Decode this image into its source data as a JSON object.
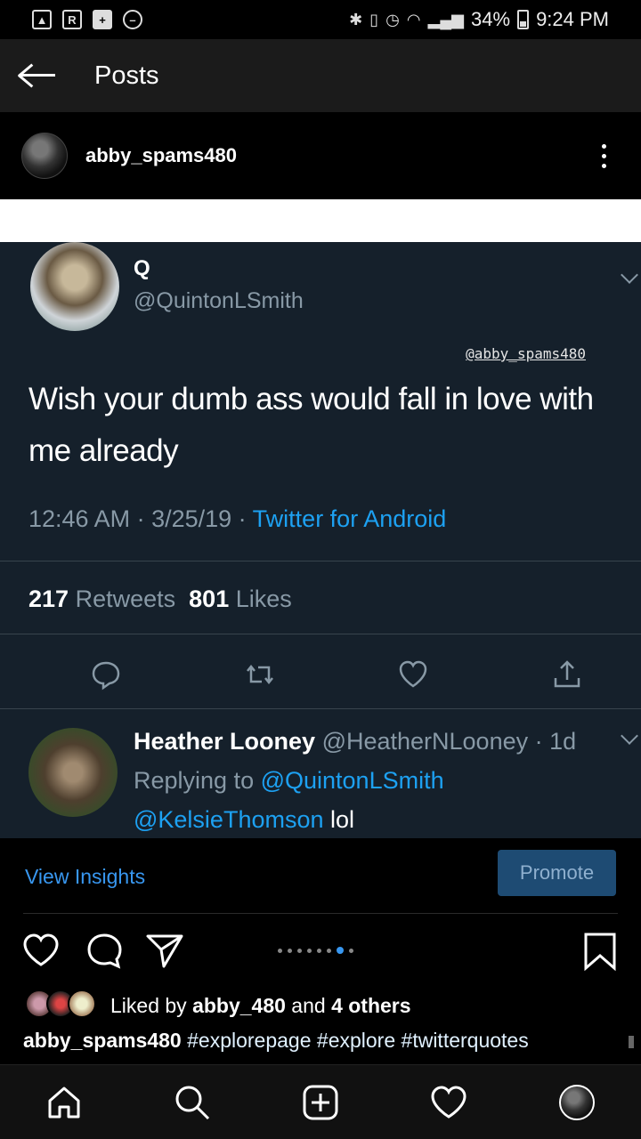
{
  "status_bar": {
    "left_icons": [
      "image-icon",
      "r-icon",
      "plus-box-icon",
      "minus-circle-icon"
    ],
    "battery": "34%",
    "time": "9:24 PM"
  },
  "header": {
    "title": "Posts"
  },
  "post": {
    "username": "abby_spams480",
    "tweet": {
      "name": "Q",
      "handle": "@QuintonLSmith",
      "watermark": "@abby_spams480",
      "text": "Wish your dumb ass would fall in love with me already",
      "time": "12:46 AM · 3/25/19 · ",
      "source": "Twitter for Android",
      "retweets_count": "217",
      "retweets_label": "Retweets",
      "likes_count": "801",
      "likes_label": "Likes",
      "reply": {
        "name": "Heather Looney",
        "handle_time": "@HeatherNLooney · 1d",
        "replying_label": "Replying to ",
        "replying_to": "@QuintonLSmith",
        "mention": "@KelsieThomson",
        "text": " lol"
      }
    },
    "view_insights": "View Insights",
    "promote": "Promote",
    "carousel": {
      "count": 8,
      "active_index": 6
    },
    "likes": {
      "prefix": "Liked by ",
      "user": "abby_480",
      "middle": " and ",
      "others": "4 others"
    },
    "caption": {
      "user": "abby_spams480",
      "tags": " #explorepage #explore #twitterquotes"
    }
  },
  "colors": {
    "accent": "#3897f0",
    "tweet_bg": "#15202b",
    "twitter_blue": "#1da1f2"
  },
  "nav": [
    "home-icon",
    "search-icon",
    "add-post-icon",
    "heart-icon",
    "profile-avatar"
  ]
}
